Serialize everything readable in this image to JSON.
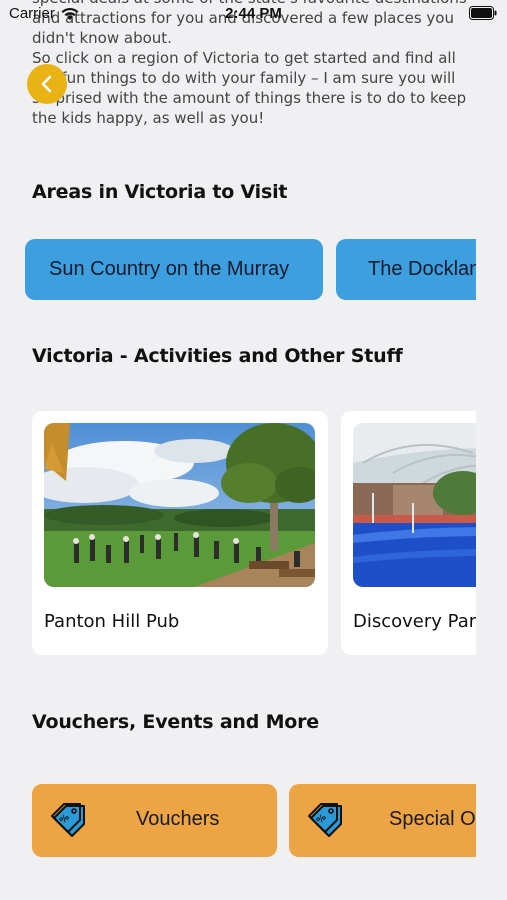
{
  "status_bar": {
    "carrier": "Carrier",
    "time": "2:44 PM"
  },
  "intro": {
    "paragraph1": "special deals at some of the state's favourite destinations and attractions for you and discovered a few places you didn't know about.",
    "paragraph2": "So click on a region of Victoria to get started and find all the fun things to do with your family – I am sure you will surprised with the amount of things there is to do to keep the kids happy, as well as you!"
  },
  "back_button": {
    "icon": "chevron-left-icon"
  },
  "areas": {
    "title": "Areas in Victoria to Visit",
    "items": [
      {
        "label": "Sun Country on the Murray"
      },
      {
        "label": "The Docklands"
      }
    ]
  },
  "activities": {
    "title": "Victoria - Activities and Other Stuff",
    "items": [
      {
        "title": "Panton Hill Pub"
      },
      {
        "title": "Discovery Park"
      }
    ]
  },
  "vouchers": {
    "title": "Vouchers, Events and More",
    "items": [
      {
        "label": "Vouchers",
        "icon": "price-tag-icon"
      },
      {
        "label": "Special Offers",
        "icon": "price-tag-icon"
      }
    ]
  },
  "colors": {
    "background": "#f0f0f3",
    "back_button": "#e9b316",
    "area_button": "#3d9fe0",
    "voucher_button": "#eca444",
    "card": "#ffffff"
  }
}
